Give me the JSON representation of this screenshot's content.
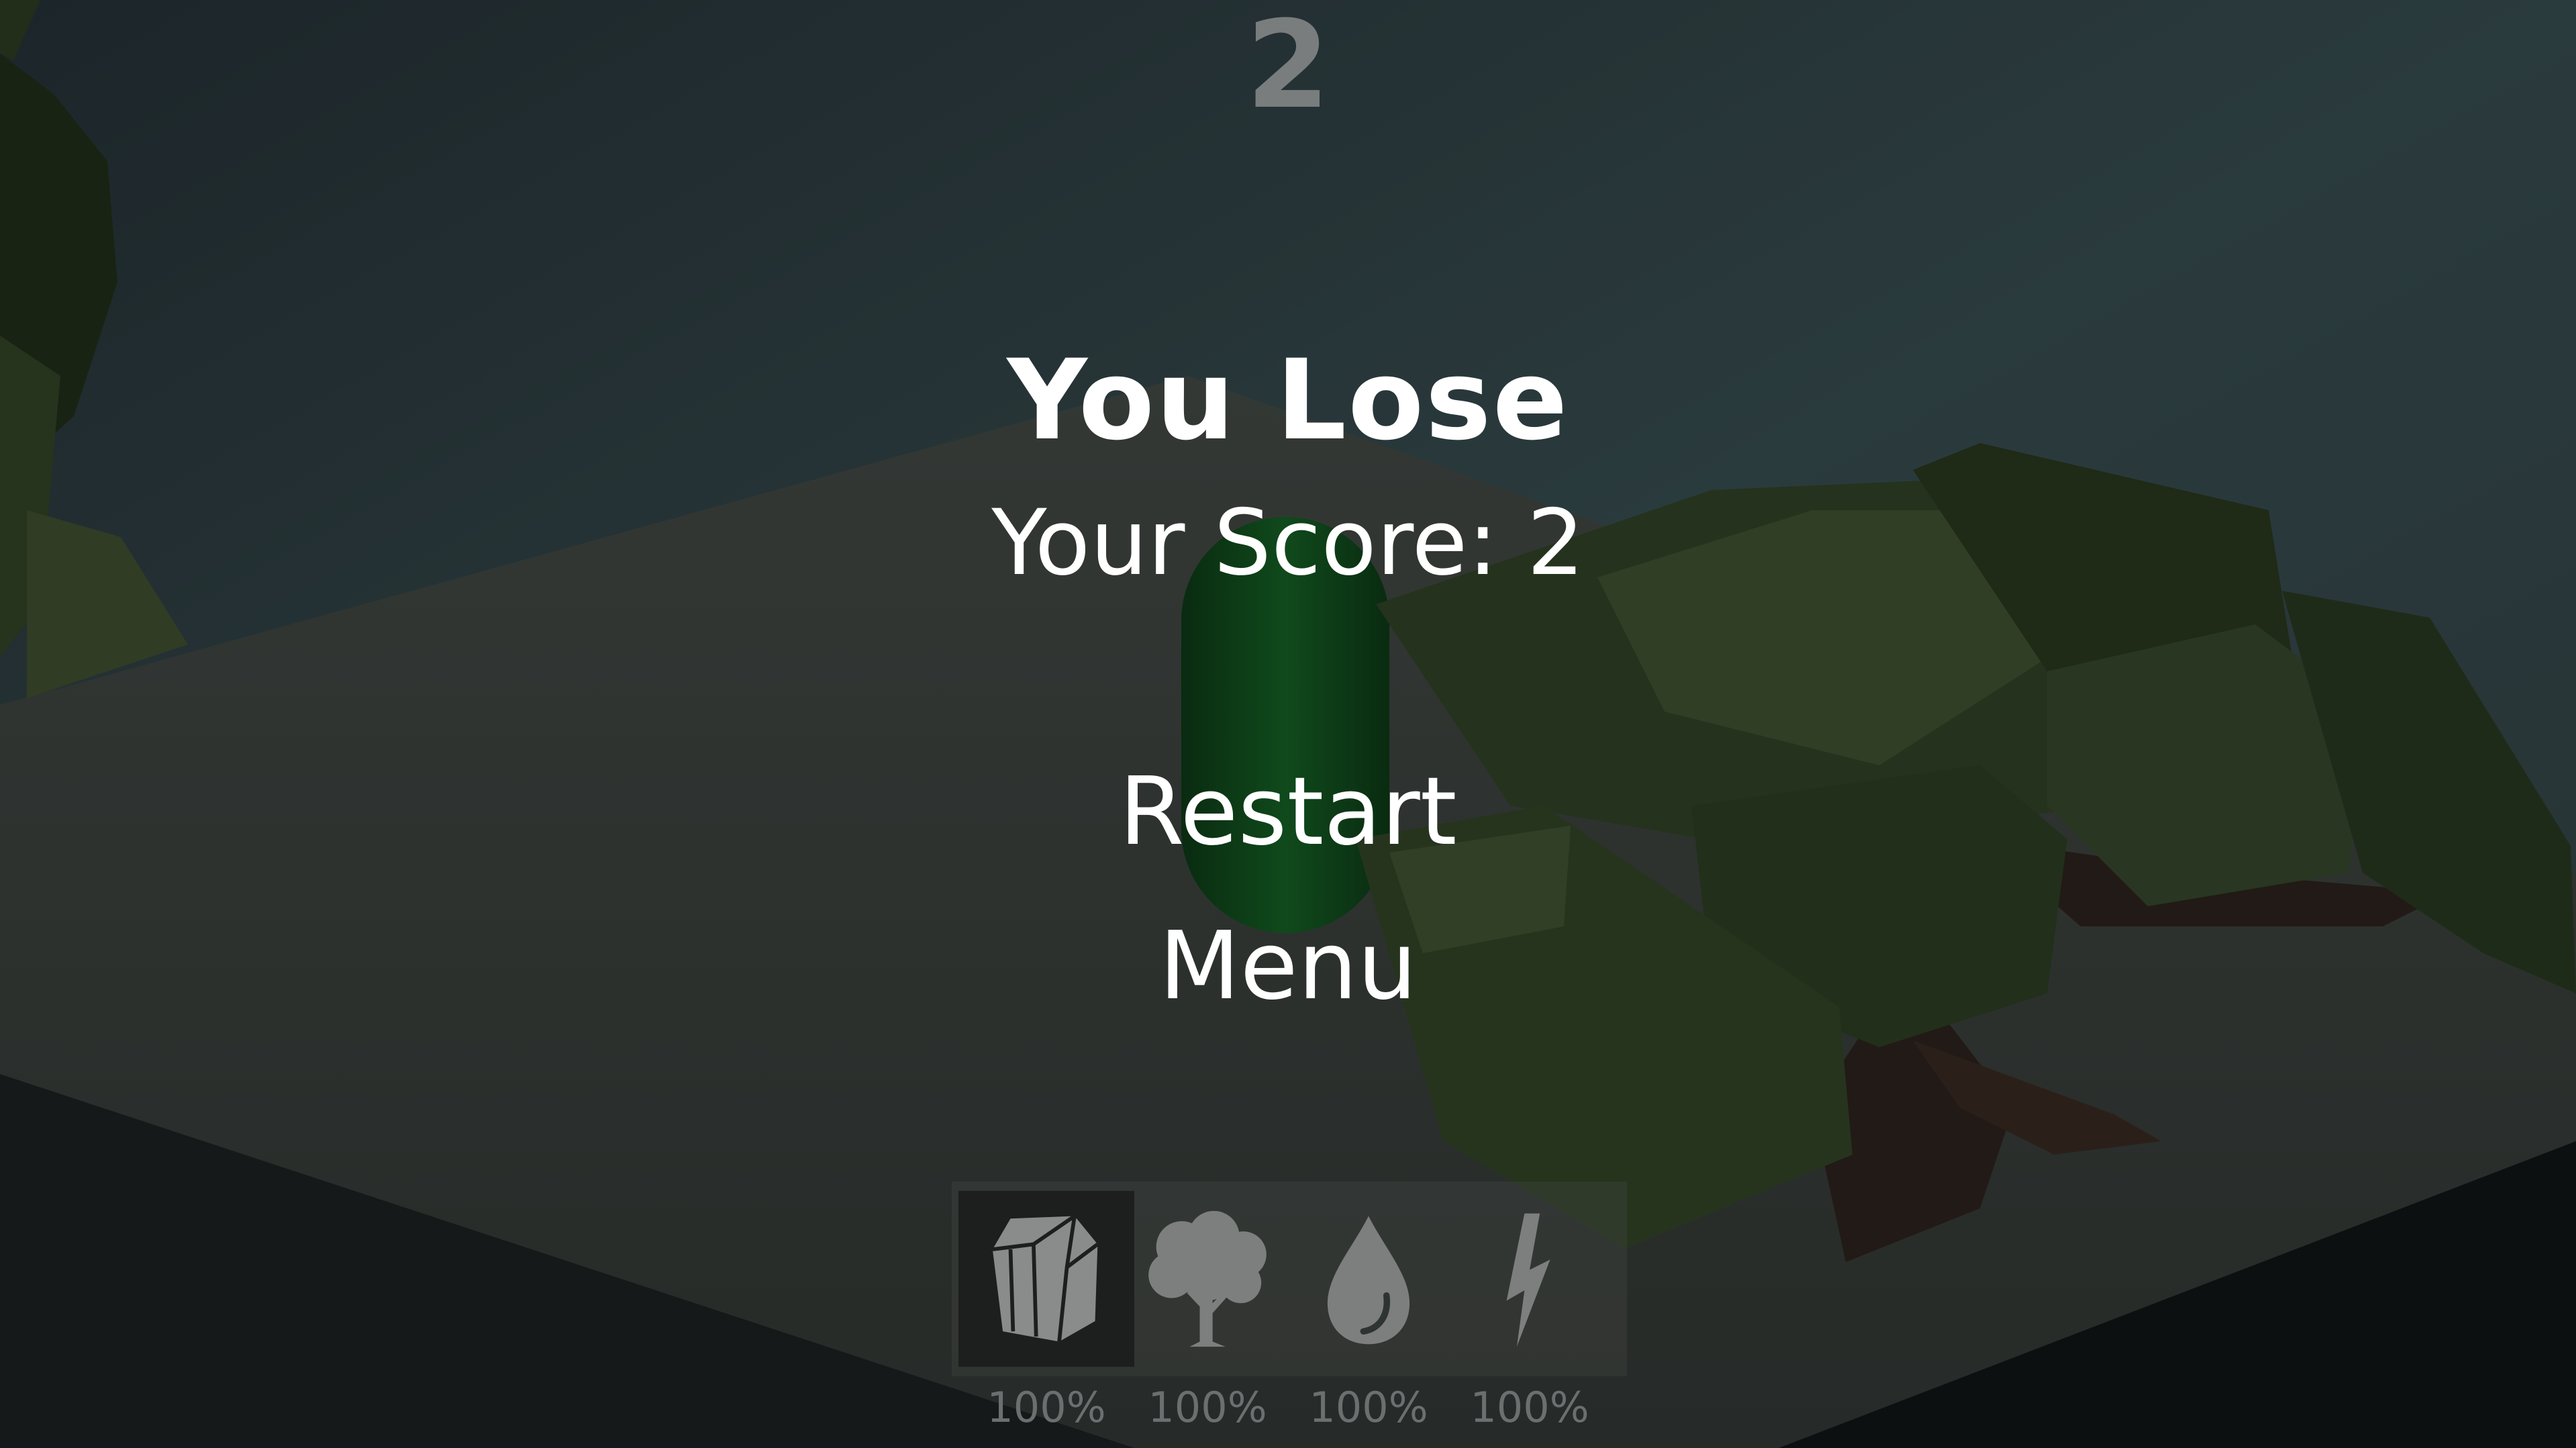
{
  "hud": {
    "score": "2",
    "title": "You Lose",
    "final_score": "Your Score: 2",
    "restart_label": "Restart",
    "menu_label": "Menu"
  },
  "toolbar": {
    "items": [
      {
        "icon": "rock-icon",
        "percent": "100%",
        "selected": true
      },
      {
        "icon": "tree-icon",
        "percent": "100%",
        "selected": false
      },
      {
        "icon": "water-drop-icon",
        "percent": "100%",
        "selected": false
      },
      {
        "icon": "lightning-icon",
        "percent": "100%",
        "selected": false
      }
    ]
  },
  "colors": {
    "sky": "#2c3b3e",
    "ground": "#3a403d",
    "foliage": "#2d3d22",
    "player": "#0f4a1c",
    "icon": "#8a8c8c",
    "hud_score": "#7a7d7d"
  }
}
